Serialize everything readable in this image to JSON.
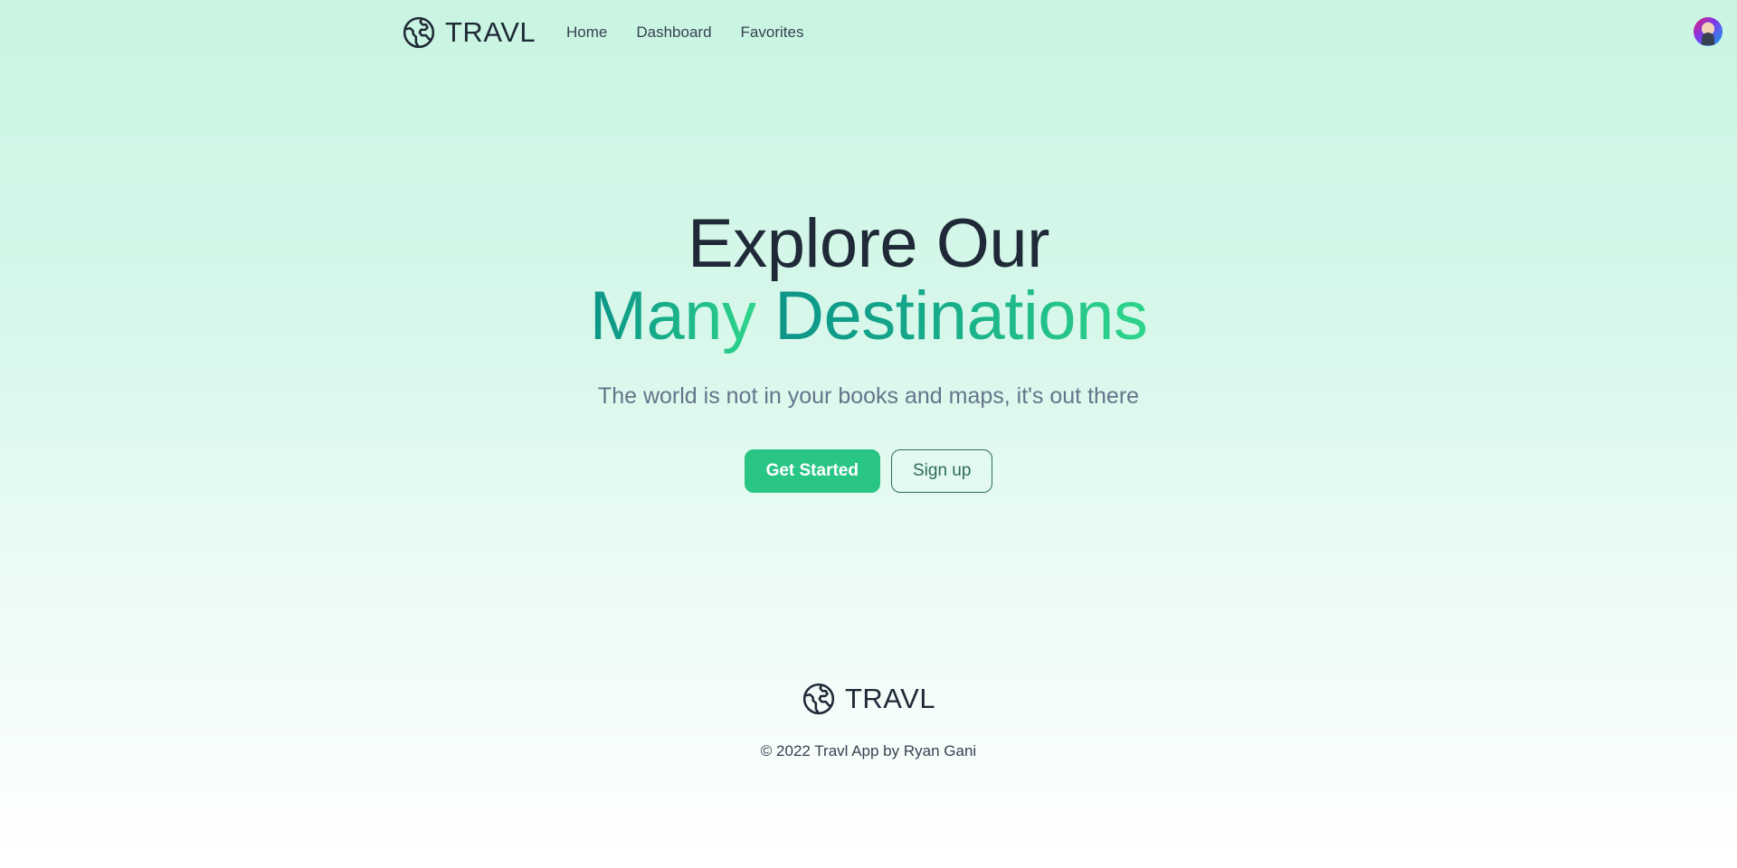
{
  "nav": {
    "brand": "TRAVL",
    "links": [
      "Home",
      "Dashboard",
      "Favorites"
    ]
  },
  "hero": {
    "title_line1": "Explore Our",
    "title_word_many": "Many",
    "title_word_destinations": "Destinations",
    "subtitle": "The world is not in your books and maps, it's out there",
    "primary_button": "Get Started",
    "secondary_button": "Sign up"
  },
  "footer": {
    "brand": "TRAVL",
    "copyright": "© 2022 Travl App by Ryan Gani"
  },
  "colors": {
    "accent": "#28c585",
    "gradient_start": "#0d9488",
    "gradient_end": "#2ed58a",
    "outline": "#2f6b56",
    "text_dark": "#1f2937",
    "text_muted": "#64748b"
  },
  "icons": {
    "brand_logo": "globe-icon",
    "footer_logo": "globe-icon",
    "user": "avatar"
  }
}
